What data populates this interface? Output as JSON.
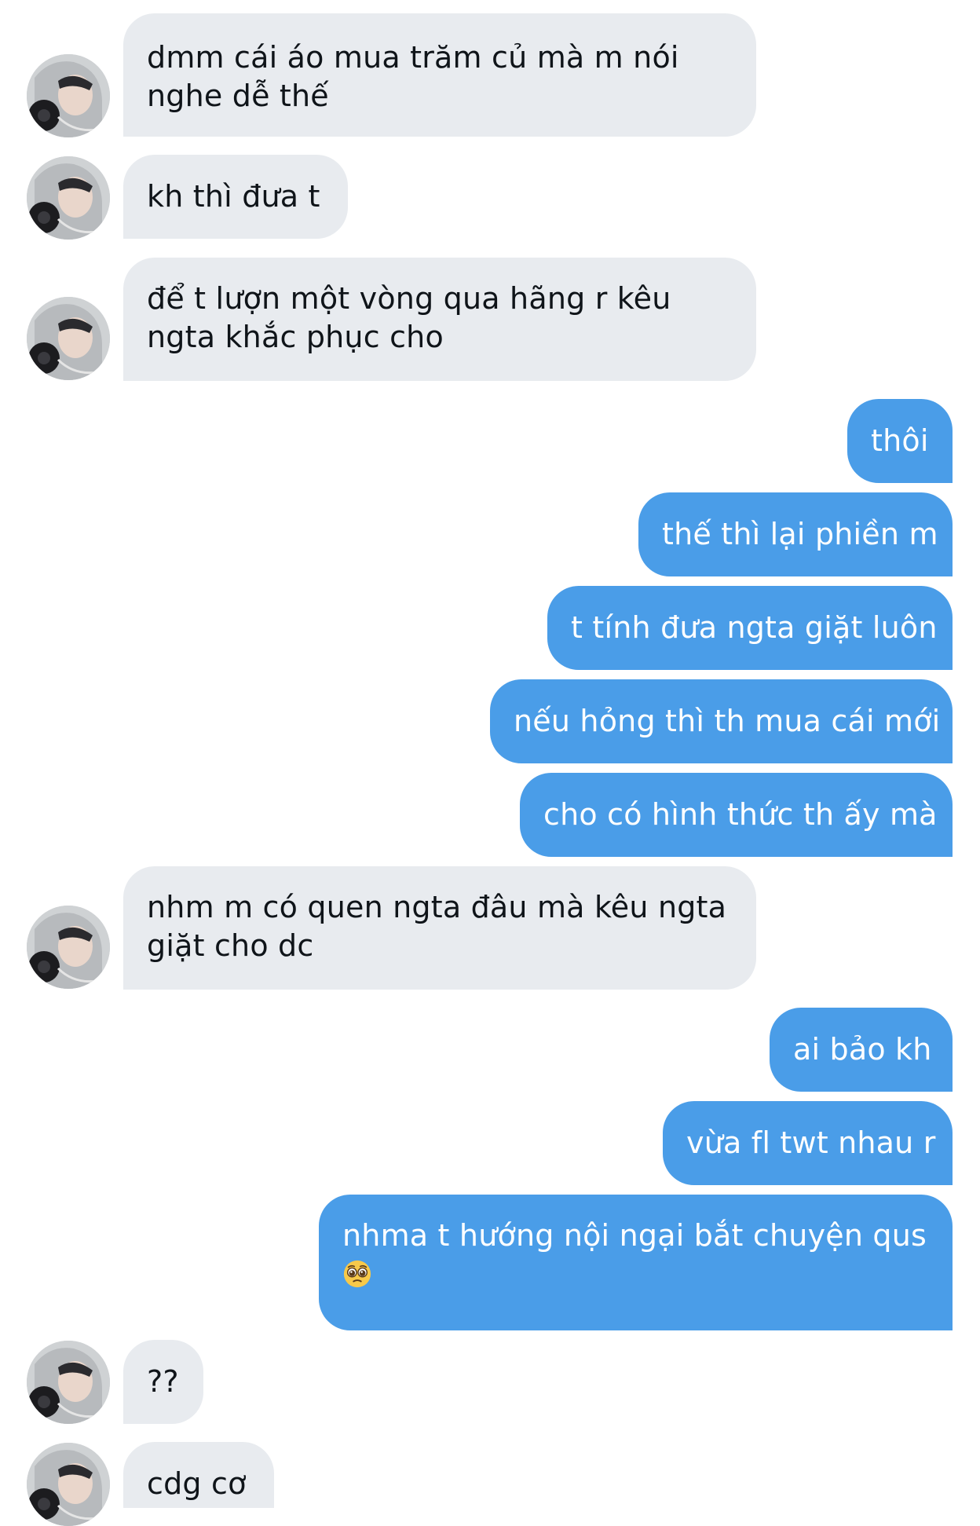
{
  "colors": {
    "incoming_bubble": "#e8ebef",
    "outgoing_bubble": "#4a9de8",
    "incoming_text": "#0f1419",
    "outgoing_text": "#ffffff"
  },
  "messages": [
    {
      "direction": "incoming",
      "lines": [
        "dmm cái áo mua trăm củ mà m nói",
        "nghe dễ thế"
      ],
      "avatar": "avatar-photo"
    },
    {
      "direction": "incoming",
      "lines": [
        "kh thì đưa t"
      ],
      "avatar": "avatar-photo"
    },
    {
      "direction": "incoming",
      "lines": [
        "để t lượn một vòng qua hãng r kêu",
        "ngta khắc phục cho"
      ],
      "avatar": "avatar-photo"
    },
    {
      "direction": "outgoing",
      "lines": [
        "thôi"
      ]
    },
    {
      "direction": "outgoing",
      "lines": [
        "thế thì lại phiền m"
      ]
    },
    {
      "direction": "outgoing",
      "lines": [
        "t tính đưa ngta giặt luôn"
      ]
    },
    {
      "direction": "outgoing",
      "lines": [
        "nếu hỏng thì th mua cái mới"
      ]
    },
    {
      "direction": "outgoing",
      "lines": [
        "cho có hình thức th ấy mà"
      ]
    },
    {
      "direction": "incoming",
      "lines": [
        "nhm m có quen ngta đâu mà kêu ngta",
        "giặt cho dc"
      ],
      "avatar": "avatar-photo"
    },
    {
      "direction": "outgoing",
      "lines": [
        "ai bảo kh"
      ]
    },
    {
      "direction": "outgoing",
      "lines": [
        "vừa fl twt nhau r"
      ]
    },
    {
      "direction": "outgoing",
      "lines": [
        "nhma t hướng nội ngại bắt chuyện qus"
      ],
      "emoji": "pleading-face-emoji"
    },
    {
      "direction": "incoming",
      "lines": [
        "??"
      ],
      "avatar": "avatar-photo"
    },
    {
      "direction": "incoming",
      "lines": [
        "cdg cơ"
      ],
      "avatar": "avatar-photo"
    }
  ]
}
